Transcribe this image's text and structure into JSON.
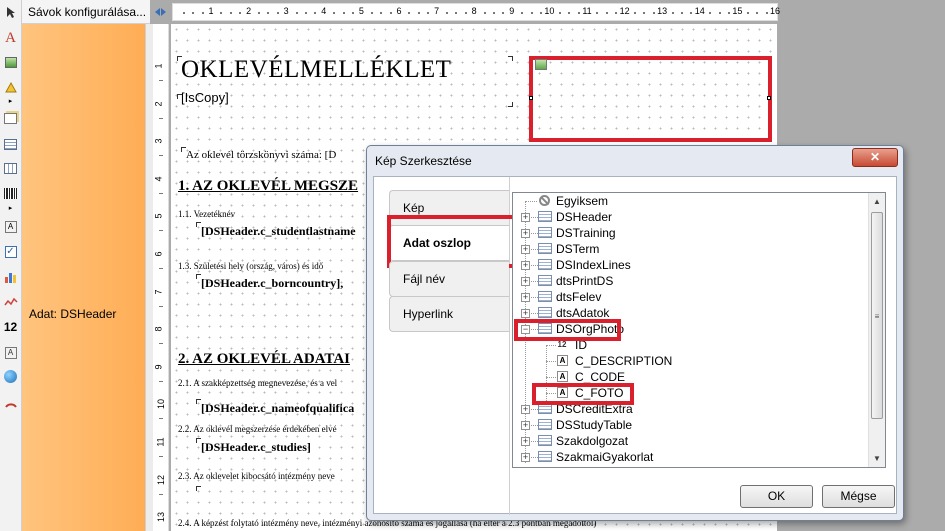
{
  "band_panel": {
    "header": "Sávok konfigurálása...",
    "band_label": "Adat: DSHeader"
  },
  "ruler": {
    "h_numbers": [
      "1",
      "2",
      "3",
      "4",
      "5",
      "6",
      "7",
      "8",
      "9",
      "10",
      "11",
      "12",
      "13",
      "14",
      "15",
      "16"
    ],
    "v_numbers": [
      "1",
      "2",
      "3",
      "4",
      "5",
      "6",
      "7",
      "8",
      "9",
      "10",
      "11",
      "12",
      "13"
    ]
  },
  "report": {
    "title": "OKLEVÉLMELLÉKLET",
    "copy_field": "[IsCopy]",
    "registry_line": "Az oklevél törzskönyvi száma: [D",
    "section1_heading": "1. AZ OKLEVÉL MEGSZE",
    "item_1_1_label": "1.1. Vezetéknév",
    "item_1_1_field": "[DSHeader.c_studentlastname",
    "item_1_3_label": "1.3. Születési hely (ország, város) és idő",
    "item_1_3_field": "[DSHeader.c_borncountry],",
    "section2_heading": "2. AZ OKLEVÉL ADATAI",
    "item_2_1_label": "2.1. A szakképzettség megnevezése, és a vel",
    "item_2_1_field": "[DSHeader.c_nameofqualifica",
    "item_2_2_label": "2.2. Az oklevél megszerzése érdekében elvé",
    "item_2_2_field": "[DSHeader.c_studies]",
    "item_2_3_label": "2.3. Az oklevelet kibocsátó intézmény neve",
    "item_2_4_label": "2.4. A képzést folytató intézmény neve, intézményi azonosító száma és jogállása (ha eltér a 2.3 pontban megadottól)"
  },
  "dialog": {
    "title": "Kép Szerkesztése",
    "close_label": "✕",
    "tabs": [
      "Kép",
      "Adat oszlop",
      "Fájl név",
      "Hyperlink"
    ],
    "active_tab": "Adat oszlop",
    "tree": {
      "items": [
        "Egyiksem",
        "DSHeader",
        "DSTraining",
        "DSTerm",
        "DSIndexLines",
        "dtsPrintDS",
        "dtsFelev",
        "dtsAdatok",
        "DSOrgPhoto",
        "ID",
        "C_DESCRIPTION",
        "C_CODE",
        "C_FOTO",
        "DSCreditExtra",
        "DSStudyTable",
        "Szakdolgozat",
        "SzakmaiGyakorlat"
      ],
      "expanded": "DSOrgPhoto",
      "selected": "C_FOTO"
    },
    "ok_label": "OK",
    "cancel_label": "Mégse"
  },
  "icons": {
    "plus": "+",
    "minus": "−",
    "field_text": "A",
    "field_number": "12",
    "scroll_up": "▲",
    "scroll_down": "▼",
    "scroll_grip": "≡"
  },
  "colors": {
    "highlight": "#d9202c",
    "band": "#ffb866"
  }
}
